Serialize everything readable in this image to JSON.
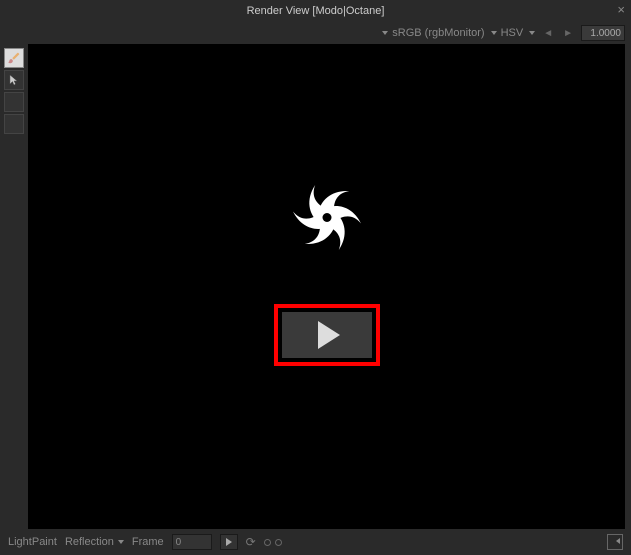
{
  "title": "Render View [Modo|Octane]",
  "toolbar": {
    "colorspace": "sRGB (rgbMonitor)",
    "colormodel": "HSV",
    "value": "1.0000"
  },
  "sidebar": {
    "tools": [
      {
        "name": "brush-tool"
      },
      {
        "name": "pointer-tool"
      },
      {
        "name": "empty-slot-1"
      },
      {
        "name": "empty-slot-2"
      }
    ]
  },
  "statusbar": {
    "mode_label": "LightPaint",
    "submode_label": "Reflection",
    "frame_label": "Frame",
    "frame_value": "0"
  }
}
